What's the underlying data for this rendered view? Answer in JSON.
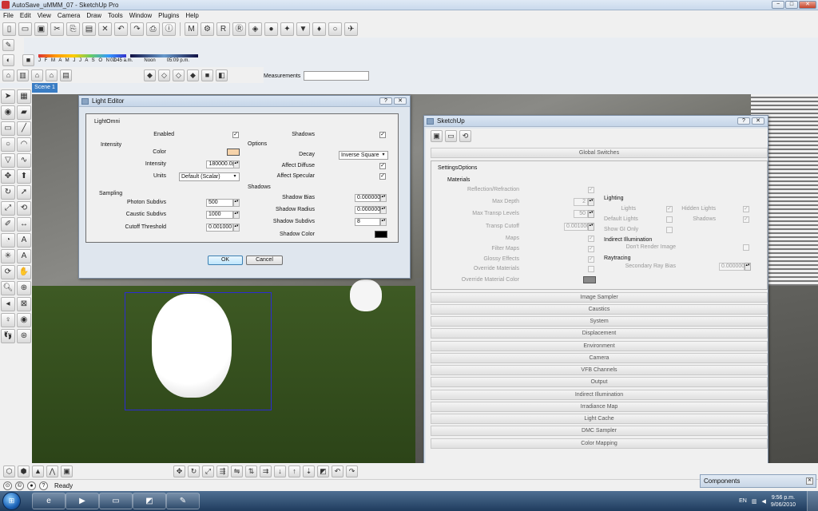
{
  "window": {
    "title": "AutoSave_uMMM_07 - SketchUp Pro",
    "min": "−",
    "max": "□",
    "close": "✕"
  },
  "menu": [
    "File",
    "Edit",
    "View",
    "Camera",
    "Draw",
    "Tools",
    "Window",
    "Plugins",
    "Help"
  ],
  "shadow": {
    "months": "J F M A M J J A S O N D",
    "time_start": "07:45 a.m.",
    "time_mid": "Noon",
    "time_end": "05:09 p.m."
  },
  "measurements_label": "Measurements",
  "scene_tab": "Scene 1",
  "light_editor": {
    "title": "Light Editor",
    "help": "?",
    "close": "✕",
    "group": "LightOmni",
    "enabled_label": "Enabled",
    "intensity_section": "Intensity",
    "color_label": "Color",
    "color_value": "#f6d3aa",
    "intensity_label": "Intensity",
    "intensity_value": "180000.0(",
    "units_label": "Units",
    "units_value": "Default (Scalar)",
    "sampling_section": "Sampling",
    "photon_label": "Photon Subdivs",
    "photon_value": "500",
    "caustic_label": "Caustic Subdivs",
    "caustic_value": "1000",
    "cutoff_label": "Cutoff Threshold",
    "cutoff_value": "0.001000",
    "shadows_label": "Shadows",
    "options_section": "Options",
    "decay_label": "Decay",
    "decay_value": "Inverse Square",
    "affect_diffuse_label": "Affect Diffuse",
    "affect_specular_label": "Affect Specular",
    "shadows_section": "Shadows",
    "shadow_bias_label": "Shadow Bias",
    "shadow_bias_value": "0.000000",
    "shadow_radius_label": "Shadow Radius",
    "shadow_radius_value": "0.000000",
    "shadow_subdivs_label": "Shadow Subdivs",
    "shadow_subdivs_value": "8",
    "shadow_color_label": "Shadow Color",
    "shadow_color_value": "#000000",
    "ok": "OK",
    "cancel": "Cancel"
  },
  "vray": {
    "title": "SketchUp",
    "help": "?",
    "close": "✕",
    "global_switches": "Global Switches",
    "settings_label": "SettingsOptions",
    "materials_section": "Materials",
    "reflection_label": "Reflection/Refraction",
    "max_depth_label": "Max Depth",
    "max_depth_value": "2",
    "max_transp_label": "Max Transp Levels",
    "max_transp_value": "50",
    "transp_cutoff_label": "Transp Cutoff",
    "transp_cutoff_value": "0.001000",
    "maps_label": "Maps",
    "filter_maps_label": "Filter Maps",
    "glossy_label": "Glossy Effects",
    "override_mat_label": "Override Materials",
    "override_color_label": "Override Material Color",
    "override_color_value": "#8a8a8a",
    "lighting_section": "Lighting",
    "lights_label": "Lights",
    "hidden_lights_label": "Hidden Lights",
    "default_lights_label": "Default Lights",
    "shadows_label": "Shadows",
    "show_gi_label": "Show GI Only",
    "indirect_section": "Indirect Illumination",
    "dont_render_label": "Don't Render Image",
    "raytracing_section": "Raytracing",
    "secondary_bias_label": "Secondary Ray Bias",
    "secondary_bias_value": "0.000000",
    "rollouts": [
      "Image Sampler",
      "Caustics",
      "System",
      "Displacement",
      "Environment",
      "Camera",
      "VFB Channels",
      "Output",
      "Indirect Illumination",
      "Irradiance Map",
      "Light Cache",
      "DMC Sampler",
      "Color Mapping"
    ]
  },
  "status": {
    "ready": "Ready"
  },
  "components": {
    "label": "Components",
    "close": "✕"
  },
  "taskbar": {
    "lang": "EN",
    "time": "9:56 p.m.",
    "date": "9/06/2010"
  }
}
